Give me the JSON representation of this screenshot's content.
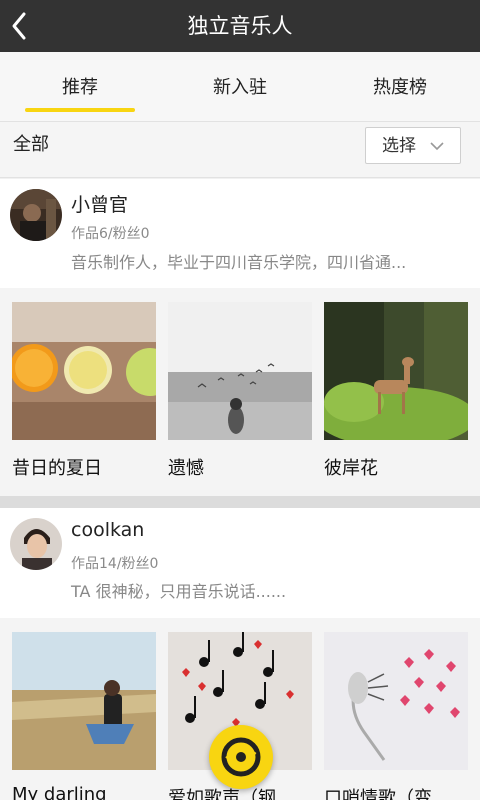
{
  "header": {
    "title": "独立音乐人"
  },
  "tabs": [
    {
      "label": "推荐",
      "active": true
    },
    {
      "label": "新入驻",
      "active": false
    },
    {
      "label": "热度榜",
      "active": false
    }
  ],
  "filter": {
    "all_label": "全部",
    "select_label": "选择"
  },
  "colors": {
    "accent": "#f8d511",
    "topbar": "#333333"
  },
  "artists": [
    {
      "name": "小曾官",
      "stats": "作品6/粉丝0",
      "desc": "音乐制作人，毕业于四川音乐学院，四川省通...",
      "works": [
        {
          "title": "昔日的夏日"
        },
        {
          "title": "遗憾"
        },
        {
          "title": "彼岸花"
        }
      ]
    },
    {
      "name": "coolkan",
      "stats": "作品14/粉丝0",
      "desc": "TA 很神秘，只用音乐说话......",
      "works": [
        {
          "title": "My darling"
        },
        {
          "title": "爱如歌声（钢..."
        },
        {
          "title": "口哨情歌（变..."
        }
      ]
    }
  ],
  "fab": {
    "icon": "music-disc-icon"
  }
}
